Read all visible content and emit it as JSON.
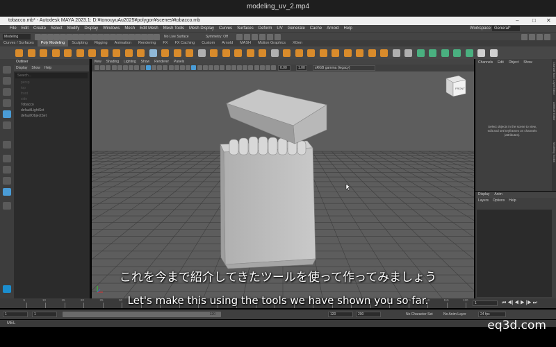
{
  "player": {
    "title": "modeling_uv_2.mp4"
  },
  "window": {
    "title": "tobacco.mb* - Autodesk MAYA 2023.1: D:¥tonouyuAu2025¥polygon¥scenes¥tobacco.mb",
    "minimize": "–",
    "maximize": "□",
    "close": "✕"
  },
  "menubar": [
    "File",
    "Edit",
    "Create",
    "Select",
    "Modify",
    "Display",
    "Windows",
    "Mesh",
    "Edit Mesh",
    "Mesh Tools",
    "Mesh Display",
    "Curves",
    "Surfaces",
    "Deform",
    "UV",
    "Generate",
    "Cache",
    "Arnold",
    "Help"
  ],
  "workspace": {
    "label": "Workspace :",
    "value": "General*"
  },
  "statusline": {
    "mode": "Modeling",
    "live_surface": "No Live Surface",
    "symmetry": "Symmetry: Off"
  },
  "shelf_tabs": [
    "Curves / Surfaces",
    "Poly Modeling",
    "Sculpting",
    "Rigging",
    "Animation",
    "Rendering",
    "FX",
    "FX Caching",
    "Custom",
    "Arnold",
    "MASH",
    "Motion Graphics",
    "XGen"
  ],
  "shelf_active": "Poly Modeling",
  "outliner": {
    "title": "Outliner",
    "menu": [
      "Display",
      "Show",
      "Help"
    ],
    "search_placeholder": "Search...",
    "items": [
      {
        "label": "persp",
        "dim": true
      },
      {
        "label": "top",
        "dim": true
      },
      {
        "label": "front",
        "dim": true
      },
      {
        "label": "side",
        "dim": true
      },
      {
        "label": "Tobacco",
        "dim": false
      },
      {
        "label": "defaultLightSet",
        "dim": false
      },
      {
        "label": "defaultObjectSet",
        "dim": false
      }
    ]
  },
  "viewport": {
    "menu": [
      "View",
      "Shading",
      "Lighting",
      "Show",
      "Renderer",
      "Panels"
    ],
    "exposure": "0.00",
    "gamma": "1.00",
    "color_space": "sRGB gamma (legacy)",
    "viewcube_label": "FRONT"
  },
  "channel_box": {
    "tabs": [
      "Channels",
      "Edit",
      "Object",
      "Show"
    ],
    "hint": "Select objects in the scene to view, edit and set keyframes on channels (attributes).",
    "side_tabs": [
      "Channel Box / Layer Editor",
      "Attribute Editor",
      "Modeling Toolkit"
    ]
  },
  "layer_editor": {
    "tabs": [
      "Display",
      "Anim"
    ],
    "menu": [
      "Layers",
      "Options",
      "Help"
    ]
  },
  "timeline": {
    "ticks": [
      "5",
      "10",
      "15",
      "20",
      "25",
      "30",
      "35",
      "40",
      "45",
      "50",
      "55",
      "60",
      "65",
      "70",
      "75",
      "80",
      "85",
      "90",
      "95",
      "100",
      "105",
      "110",
      "115",
      "120"
    ],
    "current_frame": "1"
  },
  "range": {
    "start": "1",
    "inner_start": "1",
    "inner_end": "120",
    "end": "120",
    "anim_end": "200",
    "character_set": "No Character Set",
    "anim_layer": "No Anim Layer",
    "fps": "24 fps"
  },
  "command_line": {
    "label": "MEL"
  },
  "subtitles": {
    "japanese": "これを今まで紹介してきたツールを使って作ってみましょう",
    "english": "Let's make this using the tools we have shown you so far."
  },
  "watermark": "eq3d.com",
  "colors": {
    "viewport_bg": "#5d5d5d",
    "model": "#bdbdbd",
    "grid": "#3d3d3d",
    "accent": "#4a9cd6"
  }
}
